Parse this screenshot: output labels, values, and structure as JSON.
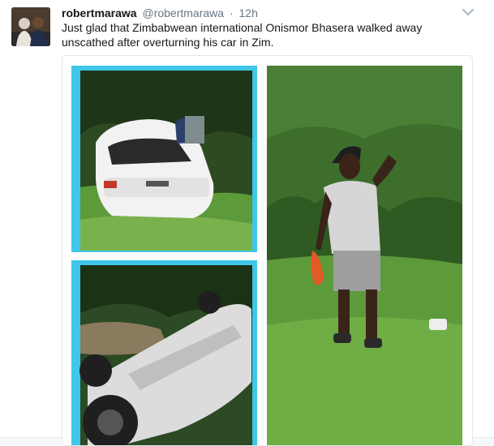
{
  "tweet": {
    "fullname": "robertmarawa",
    "username": "@robertmarawa",
    "separator": "·",
    "time": "12h",
    "text": "Just glad that Zimbabwean international Onismor Bhasera walked away unscathed after overturning his car in Zim."
  },
  "colors": {
    "frame": "#3fc6e8",
    "grass": "#5c9a3a",
    "foliage": "#2f5a22",
    "name_text": "#14171a",
    "meta_text": "#657786"
  },
  "icons": {
    "caret": "chevron-down-icon"
  }
}
